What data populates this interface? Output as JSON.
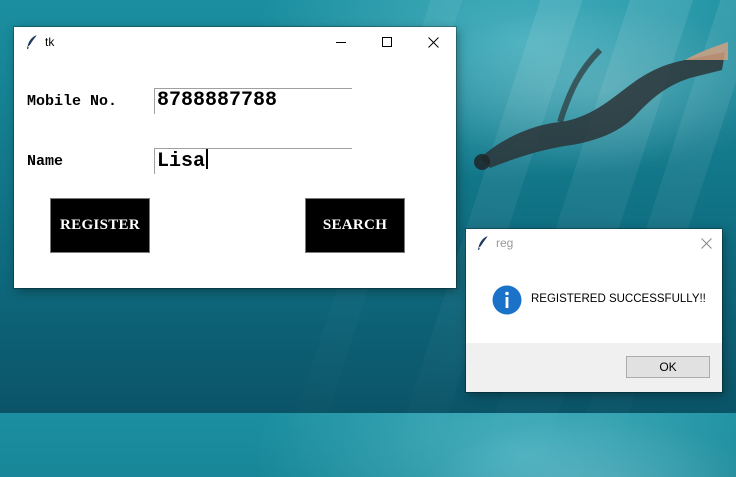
{
  "desktop": {
    "background": "underwater-diver-wallpaper"
  },
  "main_window": {
    "title": "tk",
    "icon": "feather-icon",
    "controls": {
      "minimize": "minimize-icon",
      "maximize": "maximize-icon",
      "close": "close-icon"
    },
    "form": {
      "mobile_label": "Mobile No.",
      "mobile_value": "8788887788",
      "name_label": "Name",
      "name_value": "Lisa"
    },
    "buttons": {
      "register": "REGISTER",
      "search": "SEARCH"
    }
  },
  "dialog": {
    "title": "reg",
    "icon": "feather-icon",
    "info_icon": "info-icon",
    "message": "REGISTERED SUCCESSFULLY!!",
    "ok_label": "OK"
  },
  "colors": {
    "button_bg": "#000000",
    "button_fg": "#ffffff",
    "info_blue": "#1a72c9"
  }
}
